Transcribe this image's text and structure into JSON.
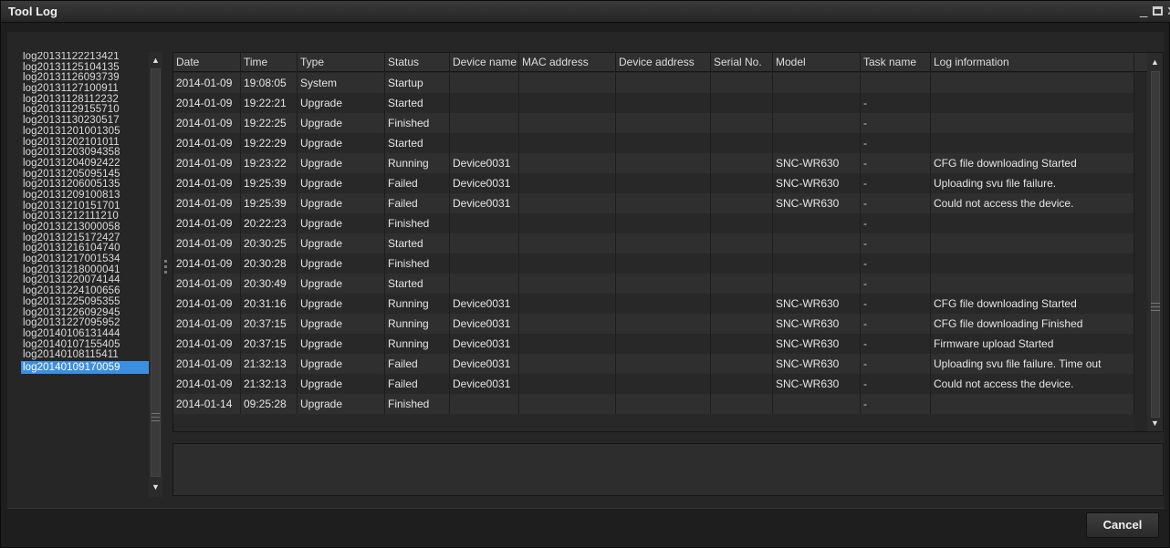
{
  "window": {
    "title": "Tool Log",
    "min_glyph": "_",
    "close_glyph": "✕"
  },
  "log_files": {
    "items": [
      "log20131122213421",
      "log20131125104135",
      "log20131126093739",
      "log20131127100911",
      "log20131128112232",
      "log20131129155710",
      "log20131130230517",
      "log20131201001305",
      "log20131202101011",
      "log20131203094358",
      "log20131204092422",
      "log20131205095145",
      "log20131206005135",
      "log20131209100813",
      "log20131210151701",
      "log20131212111210",
      "log20131213000058",
      "log20131215172427",
      "log20131216104740",
      "log20131217001534",
      "log20131218000041",
      "log20131220074144",
      "log20131224100656",
      "log20131225095355",
      "log20131226092945",
      "log20131227095952",
      "log20140106131444",
      "log20140107155405",
      "log20140108115411",
      "log20140109170059"
    ],
    "selected": "log20140109170059"
  },
  "scroll": {
    "up_glyph": "▲",
    "down_glyph": "▼"
  },
  "table": {
    "columns": [
      "Date",
      "Time",
      "Type",
      "Status",
      "Device name",
      "MAC address",
      "Device address",
      "Serial No.",
      "Model",
      "Task name",
      "Log information"
    ],
    "rows": [
      [
        "2014-01-09",
        "19:08:05",
        "System",
        "Startup",
        "",
        "",
        "",
        "",
        "",
        "",
        ""
      ],
      [
        "2014-01-09",
        "19:22:21",
        "Upgrade",
        "Started",
        "",
        "",
        "",
        "",
        "",
        "-",
        ""
      ],
      [
        "2014-01-09",
        "19:22:25",
        "Upgrade",
        "Finished",
        "",
        "",
        "",
        "",
        "",
        "-",
        ""
      ],
      [
        "2014-01-09",
        "19:22:29",
        "Upgrade",
        "Started",
        "",
        "",
        "",
        "",
        "",
        "-",
        ""
      ],
      [
        "2014-01-09",
        "19:23:22",
        "Upgrade",
        "Running",
        "Device0031",
        "",
        "",
        "",
        "SNC-WR630",
        "-",
        "CFG file downloading Started"
      ],
      [
        "2014-01-09",
        "19:25:39",
        "Upgrade",
        "Failed",
        "Device0031",
        "",
        "",
        "",
        "SNC-WR630",
        "-",
        "Uploading svu file failure."
      ],
      [
        "2014-01-09",
        "19:25:39",
        "Upgrade",
        "Failed",
        "Device0031",
        "",
        "",
        "",
        "SNC-WR630",
        "-",
        "Could not access the device."
      ],
      [
        "2014-01-09",
        "20:22:23",
        "Upgrade",
        "Finished",
        "",
        "",
        "",
        "",
        "",
        "-",
        ""
      ],
      [
        "2014-01-09",
        "20:30:25",
        "Upgrade",
        "Started",
        "",
        "",
        "",
        "",
        "",
        "-",
        ""
      ],
      [
        "2014-01-09",
        "20:30:28",
        "Upgrade",
        "Finished",
        "",
        "",
        "",
        "",
        "",
        "-",
        ""
      ],
      [
        "2014-01-09",
        "20:30:49",
        "Upgrade",
        "Started",
        "",
        "",
        "",
        "",
        "",
        "-",
        ""
      ],
      [
        "2014-01-09",
        "20:31:16",
        "Upgrade",
        "Running",
        "Device0031",
        "",
        "",
        "",
        "SNC-WR630",
        "-",
        "CFG file downloading Started"
      ],
      [
        "2014-01-09",
        "20:37:15",
        "Upgrade",
        "Running",
        "Device0031",
        "",
        "",
        "",
        "SNC-WR630",
        "-",
        "CFG file downloading Finished"
      ],
      [
        "2014-01-09",
        "20:37:15",
        "Upgrade",
        "Running",
        "Device0031",
        "",
        "",
        "",
        "SNC-WR630",
        "-",
        "Firmware upload Started"
      ],
      [
        "2014-01-09",
        "21:32:13",
        "Upgrade",
        "Failed",
        "Device0031",
        "",
        "",
        "",
        "SNC-WR630",
        "-",
        "Uploading svu file failure. Time out"
      ],
      [
        "2014-01-09",
        "21:32:13",
        "Upgrade",
        "Failed",
        "Device0031",
        "",
        "",
        "",
        "SNC-WR630",
        "-",
        "Could not access the device."
      ],
      [
        "2014-01-14",
        "09:25:28",
        "Upgrade",
        "Finished",
        "",
        "",
        "",
        "",
        "",
        "-",
        ""
      ]
    ]
  },
  "footer": {
    "cancel_label": "Cancel"
  }
}
